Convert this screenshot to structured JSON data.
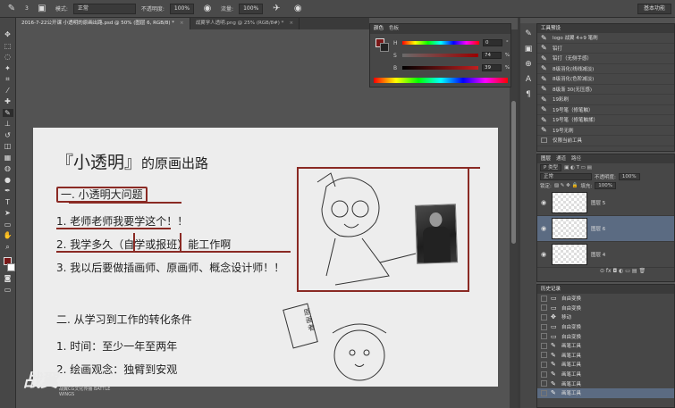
{
  "options_bar": {
    "brush_size": "3",
    "mode_label": "模式:",
    "mode_value": "正常",
    "opacity_label": "不透明度:",
    "opacity_value": "100%",
    "flow_label": "流量:",
    "flow_value": "100%",
    "workspace": "基本功能"
  },
  "tabs": [
    {
      "label": "2016-7-22公开课 小透明的原画出路.psd @ 50% (图层 6, RGB/8) *",
      "close": "×"
    },
    {
      "label": "战翼学人透明.png @ 25% (RGB/8#) *",
      "close": "×"
    }
  ],
  "document": {
    "title_open": "『",
    "title_name": "小透明",
    "title_close": "』",
    "title_rest": "的原画出路",
    "heading1": "一. 小透明大问题",
    "item1": "1. 老师老师我要学这个！！",
    "item2": "2. 我学多久（自学或报班）能工作啊",
    "item3": "3. 我以后要做插画师、原画师、概念设计师！！",
    "heading2": "二. 从学习到工作的转化条件",
    "item4": "1. 时间：至少一年至两年",
    "item5": "2. 绘画观念：独臂到安观",
    "sticker_text": "原\n画\n者"
  },
  "watermark": {
    "main": "战翼",
    "sub": "战翼CG文化传播 BATTLE WINGS"
  },
  "color_panel": {
    "tabs": [
      "颜色",
      "色板"
    ],
    "h_label": "H",
    "h_value": "0",
    "s_label": "S",
    "s_value": "74",
    "b_label": "B",
    "b_value": "39",
    "pct": "%",
    "foreground_color": "#7a1818"
  },
  "presets_panel": {
    "tabs": [
      "工具预设"
    ],
    "items": [
      "logo 战翼 4+9 笔刷",
      "铅打",
      "铅打（无侧手感）",
      "8级羽化(线线减淡)",
      "8级羽化(色阶减淡)",
      "8级渐 30(无压感)",
      "19彩刷",
      "19号笔（修笔触）",
      "19号笔（修笔触揉）",
      "19号无刷",
      "仅限当前工具"
    ]
  },
  "layers_panel": {
    "tabs": [
      "图层",
      "通道",
      "路径"
    ],
    "kind_label": "P 类型",
    "blend_mode": "正常",
    "opacity_label": "不透明度:",
    "opacity_value": "100%",
    "lock_label": "锁定:",
    "fill_label": "填充:",
    "fill_value": "100%",
    "layers": [
      {
        "name": "图层 5"
      },
      {
        "name": "图层 6"
      },
      {
        "name": "图层 4"
      }
    ],
    "footer_icons": "⊙ fx ◘ ◐ ▭ ▤ 🗑"
  },
  "history_panel": {
    "tabs": [
      "历史记录"
    ],
    "items": [
      "自由变换",
      "自由变换",
      "移动",
      "自由变换",
      "自由变换",
      "画笔工具",
      "画笔工具",
      "画笔工具",
      "画笔工具",
      "画笔工具",
      "画笔工具"
    ]
  },
  "colors": {
    "ink": "#8a2a24",
    "selected_row": "#5b6b82"
  }
}
